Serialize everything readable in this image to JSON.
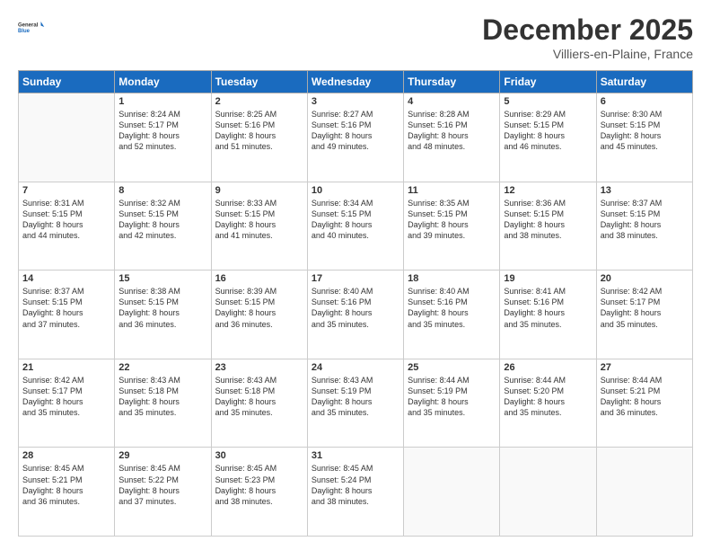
{
  "header": {
    "logo_line1": "General",
    "logo_line2": "Blue",
    "month": "December 2025",
    "location": "Villiers-en-Plaine, France"
  },
  "weekdays": [
    "Sunday",
    "Monday",
    "Tuesday",
    "Wednesday",
    "Thursday",
    "Friday",
    "Saturday"
  ],
  "weeks": [
    [
      {
        "num": "",
        "info": ""
      },
      {
        "num": "1",
        "info": "Sunrise: 8:24 AM\nSunset: 5:17 PM\nDaylight: 8 hours\nand 52 minutes."
      },
      {
        "num": "2",
        "info": "Sunrise: 8:25 AM\nSunset: 5:16 PM\nDaylight: 8 hours\nand 51 minutes."
      },
      {
        "num": "3",
        "info": "Sunrise: 8:27 AM\nSunset: 5:16 PM\nDaylight: 8 hours\nand 49 minutes."
      },
      {
        "num": "4",
        "info": "Sunrise: 8:28 AM\nSunset: 5:16 PM\nDaylight: 8 hours\nand 48 minutes."
      },
      {
        "num": "5",
        "info": "Sunrise: 8:29 AM\nSunset: 5:15 PM\nDaylight: 8 hours\nand 46 minutes."
      },
      {
        "num": "6",
        "info": "Sunrise: 8:30 AM\nSunset: 5:15 PM\nDaylight: 8 hours\nand 45 minutes."
      }
    ],
    [
      {
        "num": "7",
        "info": "Sunrise: 8:31 AM\nSunset: 5:15 PM\nDaylight: 8 hours\nand 44 minutes."
      },
      {
        "num": "8",
        "info": "Sunrise: 8:32 AM\nSunset: 5:15 PM\nDaylight: 8 hours\nand 42 minutes."
      },
      {
        "num": "9",
        "info": "Sunrise: 8:33 AM\nSunset: 5:15 PM\nDaylight: 8 hours\nand 41 minutes."
      },
      {
        "num": "10",
        "info": "Sunrise: 8:34 AM\nSunset: 5:15 PM\nDaylight: 8 hours\nand 40 minutes."
      },
      {
        "num": "11",
        "info": "Sunrise: 8:35 AM\nSunset: 5:15 PM\nDaylight: 8 hours\nand 39 minutes."
      },
      {
        "num": "12",
        "info": "Sunrise: 8:36 AM\nSunset: 5:15 PM\nDaylight: 8 hours\nand 38 minutes."
      },
      {
        "num": "13",
        "info": "Sunrise: 8:37 AM\nSunset: 5:15 PM\nDaylight: 8 hours\nand 38 minutes."
      }
    ],
    [
      {
        "num": "14",
        "info": "Sunrise: 8:37 AM\nSunset: 5:15 PM\nDaylight: 8 hours\nand 37 minutes."
      },
      {
        "num": "15",
        "info": "Sunrise: 8:38 AM\nSunset: 5:15 PM\nDaylight: 8 hours\nand 36 minutes."
      },
      {
        "num": "16",
        "info": "Sunrise: 8:39 AM\nSunset: 5:15 PM\nDaylight: 8 hours\nand 36 minutes."
      },
      {
        "num": "17",
        "info": "Sunrise: 8:40 AM\nSunset: 5:16 PM\nDaylight: 8 hours\nand 35 minutes."
      },
      {
        "num": "18",
        "info": "Sunrise: 8:40 AM\nSunset: 5:16 PM\nDaylight: 8 hours\nand 35 minutes."
      },
      {
        "num": "19",
        "info": "Sunrise: 8:41 AM\nSunset: 5:16 PM\nDaylight: 8 hours\nand 35 minutes."
      },
      {
        "num": "20",
        "info": "Sunrise: 8:42 AM\nSunset: 5:17 PM\nDaylight: 8 hours\nand 35 minutes."
      }
    ],
    [
      {
        "num": "21",
        "info": "Sunrise: 8:42 AM\nSunset: 5:17 PM\nDaylight: 8 hours\nand 35 minutes."
      },
      {
        "num": "22",
        "info": "Sunrise: 8:43 AM\nSunset: 5:18 PM\nDaylight: 8 hours\nand 35 minutes."
      },
      {
        "num": "23",
        "info": "Sunrise: 8:43 AM\nSunset: 5:18 PM\nDaylight: 8 hours\nand 35 minutes."
      },
      {
        "num": "24",
        "info": "Sunrise: 8:43 AM\nSunset: 5:19 PM\nDaylight: 8 hours\nand 35 minutes."
      },
      {
        "num": "25",
        "info": "Sunrise: 8:44 AM\nSunset: 5:19 PM\nDaylight: 8 hours\nand 35 minutes."
      },
      {
        "num": "26",
        "info": "Sunrise: 8:44 AM\nSunset: 5:20 PM\nDaylight: 8 hours\nand 35 minutes."
      },
      {
        "num": "27",
        "info": "Sunrise: 8:44 AM\nSunset: 5:21 PM\nDaylight: 8 hours\nand 36 minutes."
      }
    ],
    [
      {
        "num": "28",
        "info": "Sunrise: 8:45 AM\nSunset: 5:21 PM\nDaylight: 8 hours\nand 36 minutes."
      },
      {
        "num": "29",
        "info": "Sunrise: 8:45 AM\nSunset: 5:22 PM\nDaylight: 8 hours\nand 37 minutes."
      },
      {
        "num": "30",
        "info": "Sunrise: 8:45 AM\nSunset: 5:23 PM\nDaylight: 8 hours\nand 38 minutes."
      },
      {
        "num": "31",
        "info": "Sunrise: 8:45 AM\nSunset: 5:24 PM\nDaylight: 8 hours\nand 38 minutes."
      },
      {
        "num": "",
        "info": ""
      },
      {
        "num": "",
        "info": ""
      },
      {
        "num": "",
        "info": ""
      }
    ]
  ]
}
